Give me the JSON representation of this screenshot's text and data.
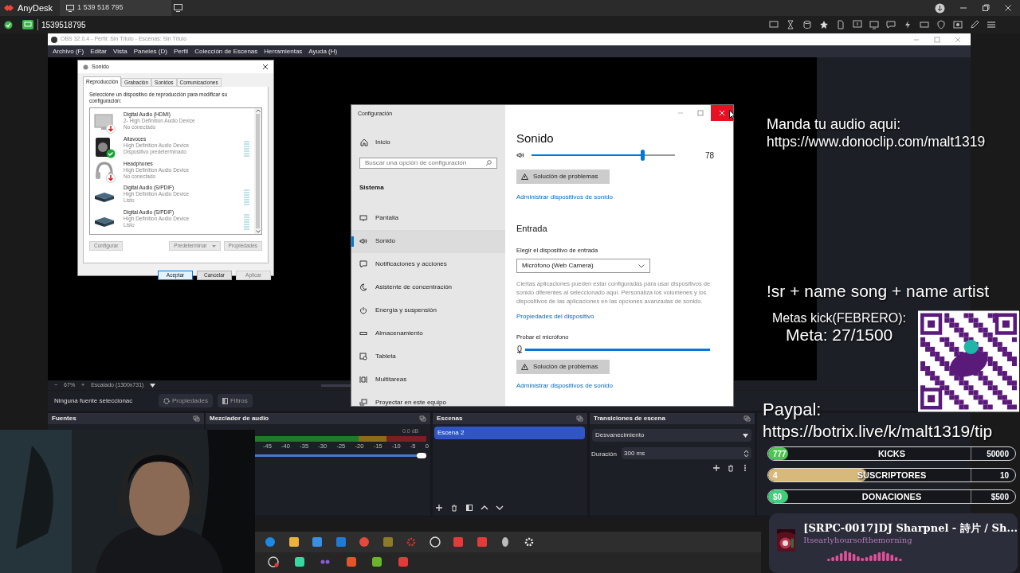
{
  "anydesk": {
    "app_name": "AnyDesk",
    "tab": "1 539 518 795",
    "address": "1539518795"
  },
  "obs": {
    "title": "OBS 32.0.4 - Perfil: Sin Título - Escenas: Sin Título",
    "menu": [
      "Archivo (F)",
      "Editar",
      "Vista",
      "Paneles (D)",
      "Perfil",
      "Colección de Escenas",
      "Herramientas",
      "Ayuda (H)"
    ],
    "zoom": {
      "minus": "−",
      "value": "67%",
      "plus": "+",
      "scale": "Escalado (1300x731)"
    },
    "source_bar": {
      "status": "Ninguna fuente seleccionac",
      "buttons": [
        "Propiedades",
        "Filtros"
      ]
    },
    "sources": {
      "title": "Fuentes"
    },
    "mixer": {
      "title": "Mezclador de audio",
      "db": "0.0 dB",
      "ticks": [
        "-45",
        "-40",
        "-35",
        "-30",
        "-25",
        "-20",
        "-15",
        "-10",
        "-5",
        "0"
      ],
      "level": 1
    },
    "scenes": {
      "title": "Escenas",
      "items": [
        {
          "label": "Escena 2",
          "selected": true
        }
      ]
    },
    "transitions": {
      "title": "Transiciones de escena",
      "type": "Desvanecimiento",
      "duration_label": "Duración",
      "duration": "300 ms"
    }
  },
  "sound_dialog": {
    "title": "Sonido",
    "tabs": [
      {
        "label": "Reproducción",
        "selected": true
      },
      {
        "label": "Grabación",
        "selected": false
      },
      {
        "label": "Sonidos",
        "selected": false
      },
      {
        "label": "Comunicaciones",
        "selected": false
      }
    ],
    "prompt": "Seleccione un dispositivo de reproducción para modificar su configuración:",
    "devices": [
      {
        "kind": "monitor",
        "name": "Digital Audio (HDMI)",
        "driver": "2- High Definition Audio Device",
        "status": "No conectado",
        "disconnected": true,
        "default": false,
        "meter": false
      },
      {
        "kind": "speaker",
        "name": "Altavoces",
        "driver": "High Definition Audio Device",
        "status": "Dispositivo predeterminado",
        "disconnected": false,
        "default": true,
        "meter": true
      },
      {
        "kind": "headphones",
        "name": "Headphones",
        "driver": "High Definition Audio Device",
        "status": "No conectado",
        "disconnected": true,
        "default": false,
        "meter": false
      },
      {
        "kind": "spdif",
        "name": "Digital Audio (S/PDIF)",
        "driver": "High Definition Audio Device",
        "status": "Listo",
        "disconnected": false,
        "default": false,
        "meter": true
      },
      {
        "kind": "spdif",
        "name": "Digital Audio (S/PDIF)",
        "driver": "High Definition Audio Device",
        "status": "Listo",
        "disconnected": false,
        "default": false,
        "meter": true
      }
    ],
    "list_buttons": [
      {
        "label": "Configurar",
        "disabled": true
      },
      {
        "label": "Predeterminar",
        "disabled": true,
        "kind": "split"
      },
      {
        "label": "Propiedades",
        "disabled": true
      }
    ],
    "footer_buttons": [
      {
        "label": "Aceptar",
        "disabled": false
      },
      {
        "label": "Cancelar",
        "disabled": false
      },
      {
        "label": "Aplicar",
        "disabled": true
      }
    ]
  },
  "settings": {
    "title": "Configuración",
    "close_hovered": true,
    "home": "Inicio",
    "search_placeholder": "Buscar una opción de configuración",
    "section": "Sistema",
    "nav": [
      {
        "label": "Pantalla",
        "selected": false
      },
      {
        "label": "Sonido",
        "selected": true
      },
      {
        "label": "Notificaciones y acciones",
        "selected": false
      },
      {
        "label": "Asistente de concentración",
        "selected": false
      },
      {
        "label": "Energía y suspensión",
        "selected": false
      },
      {
        "label": "Almacenamiento",
        "selected": false
      },
      {
        "label": "Tableta",
        "selected": false
      },
      {
        "label": "Multitareas",
        "selected": false
      },
      {
        "label": "Proyectar en este equipo",
        "selected": false
      }
    ],
    "heading": "Sonido",
    "volume": {
      "level": 0.78,
      "reading": "78"
    },
    "troubleshoot": "Solución de problemas",
    "manage_link": "Administrar dispositivos de sonido",
    "input_heading": "Entrada",
    "input_label": "Elegir el dispositivo de entrada",
    "input_device": "Micrófono (Web Camera)",
    "description": "Ciertas aplicaciones pueden estar configuradas para usar dispositivos de sonido diferentes al seleccionado aquí. Personaliza los volúmenes y los dispositivos de las aplicaciones en las opciones avanzadas de sonido.",
    "properties_link": "Propiedades del dispositivo",
    "mic_test_label": "Probar el micrófono",
    "mic": {
      "level": 1
    },
    "troubleshoot_2": "Solución de problemas",
    "manage_link_2": "Administrar dispositivos de sonido"
  },
  "overlay": {
    "audio_note": "Manda tu audio aqui:",
    "audio_url": "https://www.donoclip.com/malt1319",
    "song_request": "!sr + name song + name artist",
    "goal_title": "Metas kick(FEBRERO):",
    "goal_value": "Meta: 27/1500",
    "paypal_label": "Paypal:",
    "paypal_url": "https://botrix.live/k/malt1319/tip",
    "goals": [
      {
        "label": "KICKS",
        "value": "777",
        "target": "50000",
        "level": 0.02,
        "color": "#4cc552"
      },
      {
        "label": "SUSCRIPTORES",
        "value": "4",
        "target": "10",
        "level": 0.4,
        "color": "#d8b97c"
      },
      {
        "label": "DONACIONES",
        "value": "$0",
        "target": "$500",
        "level": 0,
        "color": "#3ecf7c"
      }
    ],
    "now_playing": {
      "title": "[SRPC-0017]DJ Sharpnel - 詩片 / Sh...",
      "artist": "Itsearlyhoursofthemorning"
    }
  }
}
